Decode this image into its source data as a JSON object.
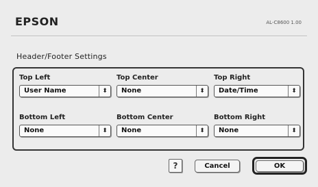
{
  "header": {
    "brand": "EPSON",
    "model": "AL-C8600 1.00"
  },
  "section_title": "Header/Footer Settings",
  "fields": {
    "top_left": {
      "label": "Top Left",
      "value": "User Name"
    },
    "top_center": {
      "label": "Top Center",
      "value": "None"
    },
    "top_right": {
      "label": "Top Right",
      "value": "Date/Time"
    },
    "bottom_left": {
      "label": "Bottom Left",
      "value": "None"
    },
    "bottom_center": {
      "label": "Bottom Center",
      "value": "None"
    },
    "bottom_right": {
      "label": "Bottom Right",
      "value": "None"
    }
  },
  "buttons": {
    "help": "?",
    "cancel": "Cancel",
    "ok": "OK"
  },
  "icons": {
    "popup_arrows": "updown-arrows-icon",
    "help": "help-icon"
  }
}
